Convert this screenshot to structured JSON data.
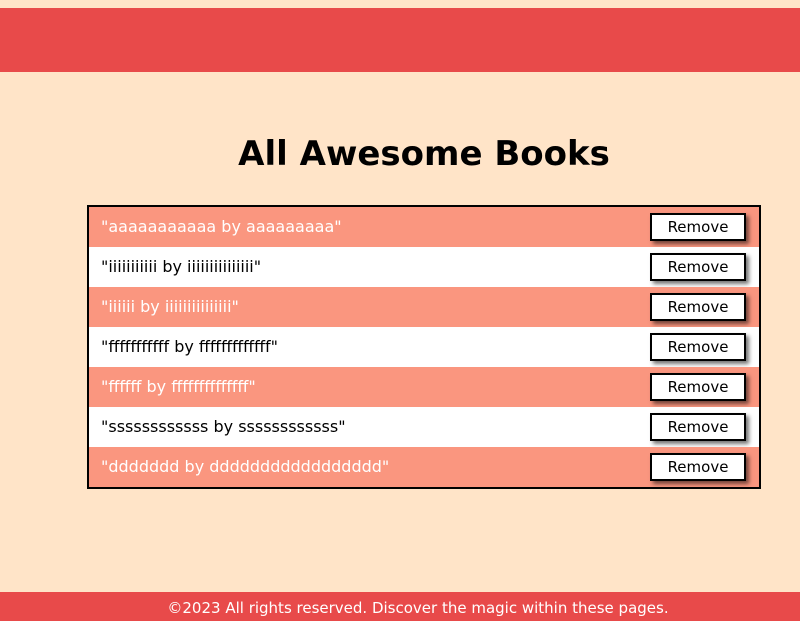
{
  "header": {
    "bar_color": "#e84a4a"
  },
  "main": {
    "title": "All Awesome Books",
    "books": [
      {
        "text": "\"aaaaaaaaaaa by aaaaaaaaa\"",
        "remove_label": "Remove"
      },
      {
        "text": "\"iiiiiiiiiii by iiiiiiiiiiiiiii\"",
        "remove_label": "Remove"
      },
      {
        "text": "\"iiiiii by iiiiiiiiiiiiiii\"",
        "remove_label": "Remove"
      },
      {
        "text": "\"fffffffffff by fffffffffffff\"",
        "remove_label": "Remove"
      },
      {
        "text": "\"ffffff by ffffffffffffff\"",
        "remove_label": "Remove"
      },
      {
        "text": "\"ssssssssssss by ssssssssssss\"",
        "remove_label": "Remove"
      },
      {
        "text": "\"ddddddd by ddddddddddddddddd\"",
        "remove_label": "Remove"
      }
    ]
  },
  "footer": {
    "text": "©2023 All rights reserved. Discover the magic within these pages."
  },
  "colors": {
    "background": "#ffe4c8",
    "accent": "#e84a4a",
    "row_alt": "#fa967f"
  }
}
